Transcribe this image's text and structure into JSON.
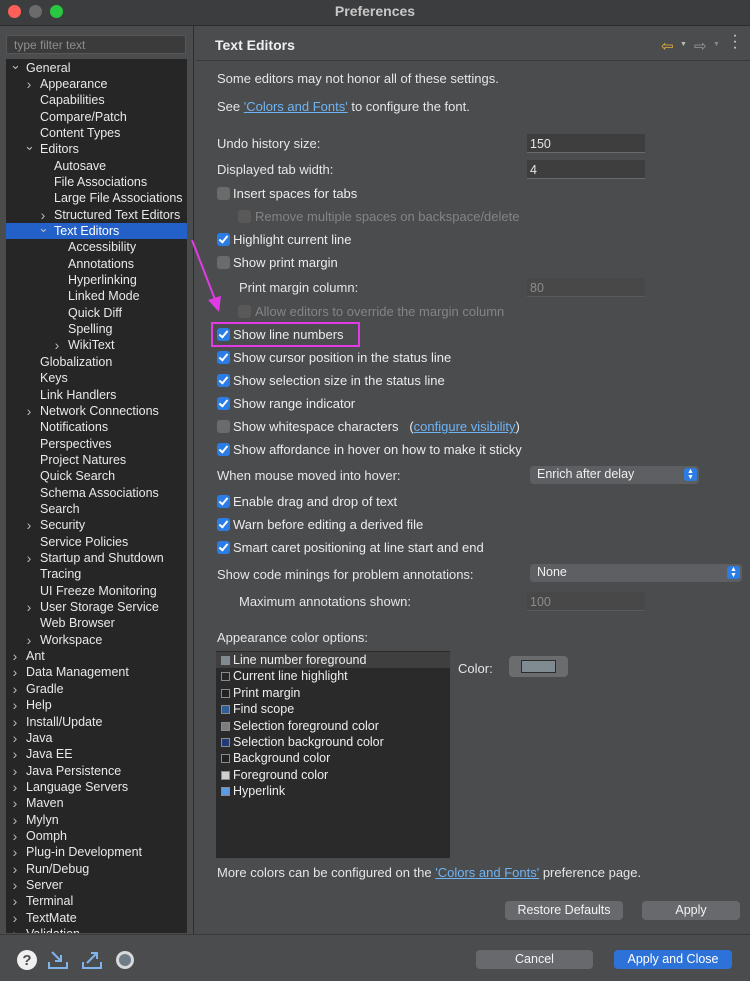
{
  "window": {
    "title": "Preferences"
  },
  "filter": {
    "placeholder": "type filter text"
  },
  "tree": [
    {
      "label": "General",
      "indent": 0,
      "twisty": "open"
    },
    {
      "label": "Appearance",
      "indent": 1,
      "twisty": "closed"
    },
    {
      "label": "Capabilities",
      "indent": 1,
      "twisty": ""
    },
    {
      "label": "Compare/Patch",
      "indent": 1,
      "twisty": ""
    },
    {
      "label": "Content Types",
      "indent": 1,
      "twisty": ""
    },
    {
      "label": "Editors",
      "indent": 1,
      "twisty": "open"
    },
    {
      "label": "Autosave",
      "indent": 2,
      "twisty": ""
    },
    {
      "label": "File Associations",
      "indent": 2,
      "twisty": ""
    },
    {
      "label": "Large File Associations",
      "indent": 2,
      "twisty": ""
    },
    {
      "label": "Structured Text Editors",
      "indent": 2,
      "twisty": "closed"
    },
    {
      "label": "Text Editors",
      "indent": 2,
      "twisty": "open",
      "selected": true
    },
    {
      "label": "Accessibility",
      "indent": 3,
      "twisty": ""
    },
    {
      "label": "Annotations",
      "indent": 3,
      "twisty": ""
    },
    {
      "label": "Hyperlinking",
      "indent": 3,
      "twisty": ""
    },
    {
      "label": "Linked Mode",
      "indent": 3,
      "twisty": ""
    },
    {
      "label": "Quick Diff",
      "indent": 3,
      "twisty": ""
    },
    {
      "label": "Spelling",
      "indent": 3,
      "twisty": ""
    },
    {
      "label": "WikiText",
      "indent": 3,
      "twisty": "closed"
    },
    {
      "label": "Globalization",
      "indent": 1,
      "twisty": ""
    },
    {
      "label": "Keys",
      "indent": 1,
      "twisty": ""
    },
    {
      "label": "Link Handlers",
      "indent": 1,
      "twisty": ""
    },
    {
      "label": "Network Connections",
      "indent": 1,
      "twisty": "closed"
    },
    {
      "label": "Notifications",
      "indent": 1,
      "twisty": ""
    },
    {
      "label": "Perspectives",
      "indent": 1,
      "twisty": ""
    },
    {
      "label": "Project Natures",
      "indent": 1,
      "twisty": ""
    },
    {
      "label": "Quick Search",
      "indent": 1,
      "twisty": ""
    },
    {
      "label": "Schema Associations",
      "indent": 1,
      "twisty": ""
    },
    {
      "label": "Search",
      "indent": 1,
      "twisty": ""
    },
    {
      "label": "Security",
      "indent": 1,
      "twisty": "closed"
    },
    {
      "label": "Service Policies",
      "indent": 1,
      "twisty": ""
    },
    {
      "label": "Startup and Shutdown",
      "indent": 1,
      "twisty": "closed"
    },
    {
      "label": "Tracing",
      "indent": 1,
      "twisty": ""
    },
    {
      "label": "UI Freeze Monitoring",
      "indent": 1,
      "twisty": ""
    },
    {
      "label": "User Storage Service",
      "indent": 1,
      "twisty": "closed"
    },
    {
      "label": "Web Browser",
      "indent": 1,
      "twisty": ""
    },
    {
      "label": "Workspace",
      "indent": 1,
      "twisty": "closed"
    },
    {
      "label": "Ant",
      "indent": 0,
      "twisty": "closed"
    },
    {
      "label": "Data Management",
      "indent": 0,
      "twisty": "closed"
    },
    {
      "label": "Gradle",
      "indent": 0,
      "twisty": "closed"
    },
    {
      "label": "Help",
      "indent": 0,
      "twisty": "closed"
    },
    {
      "label": "Install/Update",
      "indent": 0,
      "twisty": "closed"
    },
    {
      "label": "Java",
      "indent": 0,
      "twisty": "closed"
    },
    {
      "label": "Java EE",
      "indent": 0,
      "twisty": "closed"
    },
    {
      "label": "Java Persistence",
      "indent": 0,
      "twisty": "closed"
    },
    {
      "label": "Language Servers",
      "indent": 0,
      "twisty": "closed"
    },
    {
      "label": "Maven",
      "indent": 0,
      "twisty": "closed"
    },
    {
      "label": "Mylyn",
      "indent": 0,
      "twisty": "closed"
    },
    {
      "label": "Oomph",
      "indent": 0,
      "twisty": "closed"
    },
    {
      "label": "Plug-in Development",
      "indent": 0,
      "twisty": "closed"
    },
    {
      "label": "Run/Debug",
      "indent": 0,
      "twisty": "closed"
    },
    {
      "label": "Server",
      "indent": 0,
      "twisty": "closed"
    },
    {
      "label": "Terminal",
      "indent": 0,
      "twisty": "closed"
    },
    {
      "label": "TextMate",
      "indent": 0,
      "twisty": "closed"
    },
    {
      "label": "Validation",
      "indent": 0,
      "twisty": "closed"
    }
  ],
  "page": {
    "title": "Text Editors",
    "note": "Some editors may not honor all of these settings.",
    "see_prefix": "See ",
    "see_link": "'Colors and Fonts'",
    "see_suffix": " to configure the font.",
    "undo_label": "Undo history size:",
    "undo_value": "150",
    "tab_label": "Displayed tab width:",
    "tab_value": "4",
    "insert_spaces": "Insert spaces for tabs",
    "remove_spaces": "Remove multiple spaces on backspace/delete",
    "highlight_line": "Highlight current line",
    "print_margin": "Show print margin",
    "print_margin_col_label": "Print margin column:",
    "print_margin_col_value": "80",
    "allow_override": "Allow editors to override the margin column",
    "line_numbers": "Show line numbers",
    "cursor_position": "Show cursor position in the status line",
    "selection_size": "Show selection size in the status line",
    "range_indicator": "Show range indicator",
    "whitespace": "Show whitespace characters",
    "whitespace_paren_open": "(",
    "whitespace_link": "configure visibility",
    "whitespace_paren_close": ")",
    "affordance": "Show affordance in hover on how to make it sticky",
    "hover_label": "When mouse moved into hover:",
    "hover_value": "Enrich after delay",
    "drag_drop": "Enable drag and drop of text",
    "warn_derived": "Warn before editing a derived file",
    "smart_caret": "Smart caret positioning at line start and end",
    "code_minings_label": "Show code minings for problem annotations:",
    "code_minings_value": "None",
    "max_annotations_label": "Maximum annotations shown:",
    "max_annotations_value": "100",
    "appearance_label": "Appearance color options:",
    "color_label": "Color:",
    "more_prefix": "More colors can be configured on the ",
    "more_link": "'Colors and Fonts'",
    "more_suffix": " preference page."
  },
  "color_options": [
    {
      "label": "Line number foreground",
      "swatch": "#7f8a91"
    },
    {
      "label": "Current line highlight",
      "swatch": "#262626"
    },
    {
      "label": "Print margin",
      "swatch": "#222222"
    },
    {
      "label": "Find scope",
      "swatch": "#2f5f96"
    },
    {
      "label": "Selection foreground color",
      "swatch": "#7d7d7d"
    },
    {
      "label": "Selection background color",
      "swatch": "#223a7a"
    },
    {
      "label": "Background color",
      "swatch": "#222222"
    },
    {
      "label": "Foreground color",
      "swatch": "#cfcfcf"
    },
    {
      "label": "Hyperlink",
      "swatch": "#5b9be6"
    }
  ],
  "buttons": {
    "restore_defaults": "Restore Defaults",
    "apply": "Apply",
    "cancel": "Cancel",
    "apply_close": "Apply and Close"
  },
  "colors": {
    "accent": "#2c7de3",
    "highlight_box": "#e23be6",
    "selection": "#2361c8"
  }
}
